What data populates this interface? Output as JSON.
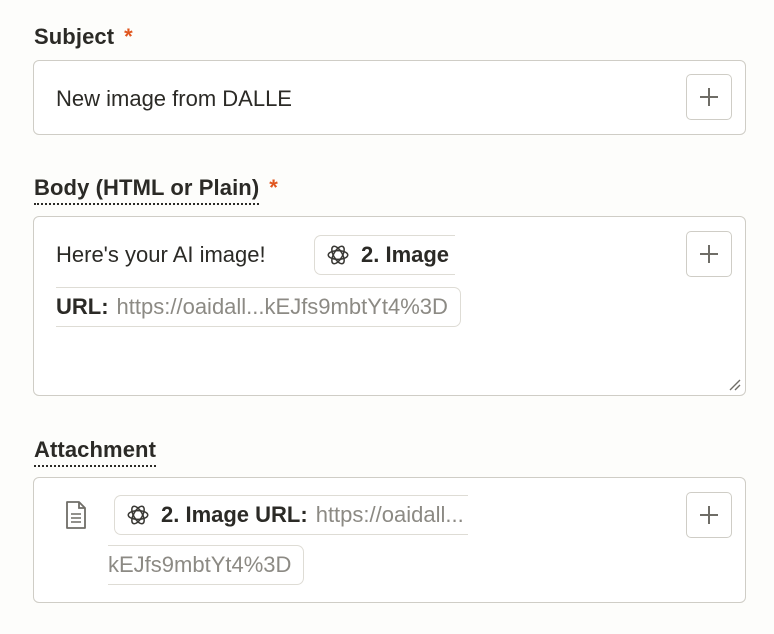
{
  "subject": {
    "label": "Subject",
    "required_mark": "*",
    "value": "New image from DALLE"
  },
  "body": {
    "label": "Body (HTML or Plain)",
    "required_mark": "*",
    "text": "Here's your AI image!",
    "token": {
      "title_part1": "2. Image",
      "title_part2": "URL:",
      "value": "https://oaidall...kEJfs9mbtYt4%3D",
      "icon": "openai-icon"
    }
  },
  "attachment": {
    "label": "Attachment",
    "file_icon": "file-icon",
    "token": {
      "title": "2. Image URL:",
      "value_part1": "https://oaidall...",
      "value_part2": "kEJfs9mbtYt4%3D",
      "icon": "openai-icon"
    }
  },
  "colors": {
    "required": "#e0561f",
    "border": "#cfcdc6",
    "muted_text": "#8c8a84"
  }
}
